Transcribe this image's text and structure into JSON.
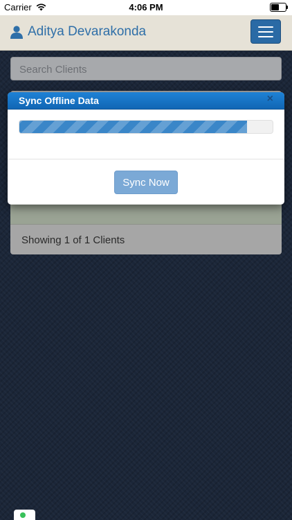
{
  "status_bar": {
    "carrier": "Carrier",
    "time": "4:06 PM",
    "battery_level": 0.55
  },
  "header": {
    "user_name": "Aditya Devarakonda"
  },
  "search": {
    "placeholder": "Search Clients"
  },
  "clients": {
    "footer_text": "Showing 1 of 1 Clients"
  },
  "modal": {
    "title": "Sync Offline Data",
    "close_label": "×",
    "progress": 0.9,
    "button_label": "Sync Now"
  },
  "colors": {
    "accent": "#2a6aa5",
    "modal_header": "#1571c4",
    "progress_bar": "#3a86c8",
    "header_bg": "#e6e2d7"
  }
}
